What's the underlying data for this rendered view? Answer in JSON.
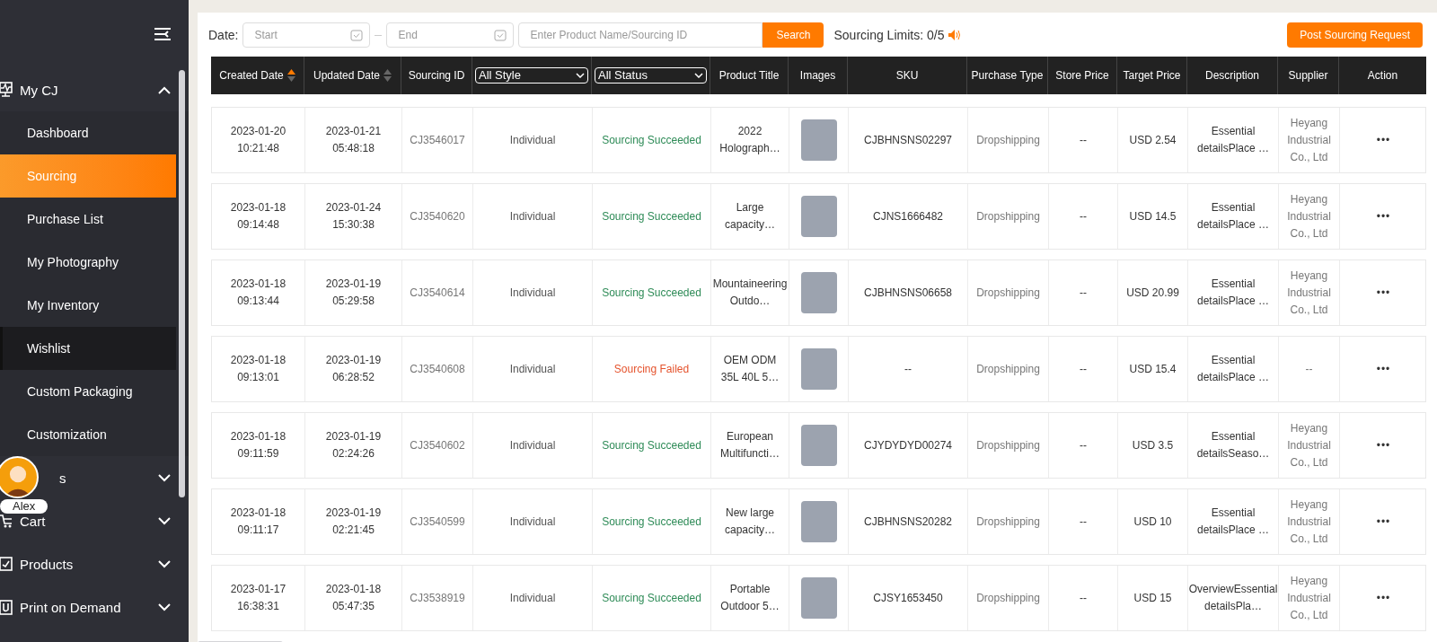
{
  "sidebar": {
    "groups": [
      {
        "label": "My CJ",
        "expanded": true,
        "children": [
          {
            "label": "Dashboard",
            "selected": false,
            "hovered": false
          },
          {
            "label": "Sourcing",
            "selected": true,
            "hovered": false
          },
          {
            "label": "Purchase List",
            "selected": false,
            "hovered": false
          },
          {
            "label": "My Photography",
            "selected": false,
            "hovered": false
          },
          {
            "label": "My Inventory",
            "selected": false,
            "hovered": false
          },
          {
            "label": "Wishlist",
            "selected": false,
            "hovered": true
          },
          {
            "label": "Custom Packaging",
            "selected": false,
            "hovered": false
          },
          {
            "label": "Customization",
            "selected": false,
            "hovered": false
          }
        ]
      },
      {
        "label": "s",
        "expanded": false
      },
      {
        "label": "Cart",
        "expanded": false
      },
      {
        "label": "Products",
        "expanded": false
      },
      {
        "label": "Print on Demand",
        "expanded": false
      }
    ],
    "user": {
      "name": "Alex"
    }
  },
  "toolbar": {
    "date_label": "Date:",
    "start_placeholder": "Start",
    "end_placeholder": "End",
    "search_placeholder": "Enter Product Name/Sourcing ID",
    "search_button": "Search",
    "limits": "Sourcing Limits: 0/5",
    "post_button": "Post Sourcing Request"
  },
  "table": {
    "columns": [
      {
        "kind": "sort",
        "label": "Created Date",
        "sorted": true
      },
      {
        "kind": "sort",
        "label": "Updated Date",
        "sorted": false
      },
      {
        "kind": "text",
        "label": "Sourcing ID"
      },
      {
        "kind": "select",
        "label": "All Style"
      },
      {
        "kind": "select",
        "label": "All Status"
      },
      {
        "kind": "text",
        "label": "Product Title"
      },
      {
        "kind": "text",
        "label": "Images"
      },
      {
        "kind": "text",
        "label": "SKU"
      },
      {
        "kind": "text",
        "label": "Purchase Type"
      },
      {
        "kind": "text",
        "label": "Store Price"
      },
      {
        "kind": "text",
        "label": "Target Price"
      },
      {
        "kind": "text",
        "label": "Description"
      },
      {
        "kind": "text",
        "label": "Supplier"
      },
      {
        "kind": "text",
        "label": "Action"
      }
    ],
    "rows": [
      {
        "created": "2023-01-20 10:21:48",
        "updated": "2023-01-21 05:48:18",
        "id": "CJ3546017",
        "style": "Individual",
        "status": "Sourcing Succeeded",
        "failed": false,
        "title": "2022 Holograph…",
        "sku": "CJBHNSNS02297",
        "purchase_type": "Dropshipping",
        "store_price": "--",
        "target_price": "USD 2.54",
        "description": "Essential detailsPlace …",
        "supplier": "Heyang Industrial Co., Ltd",
        "action": "•••"
      },
      {
        "created": "2023-01-18 09:14:48",
        "updated": "2023-01-24 15:30:38",
        "id": "CJ3540620",
        "style": "Individual",
        "status": "Sourcing Succeeded",
        "failed": false,
        "title": "Large capacity…",
        "sku": "CJNS1666482",
        "purchase_type": "Dropshipping",
        "store_price": "--",
        "target_price": "USD 14.5",
        "description": "Essential detailsPlace …",
        "supplier": "Heyang Industrial Co., Ltd",
        "action": "•••"
      },
      {
        "created": "2023-01-18 09:13:44",
        "updated": "2023-01-19 05:29:58",
        "id": "CJ3540614",
        "style": "Individual",
        "status": "Sourcing Succeeded",
        "failed": false,
        "title": "Mountaineering Outdo…",
        "sku": "CJBHNSNS06658",
        "purchase_type": "Dropshipping",
        "store_price": "--",
        "target_price": "USD 20.99",
        "description": "Essential detailsPlace …",
        "supplier": "Heyang Industrial Co., Ltd",
        "action": "•••"
      },
      {
        "created": "2023-01-18 09:13:01",
        "updated": "2023-01-19 06:28:52",
        "id": "CJ3540608",
        "style": "Individual",
        "status": "Sourcing Failed",
        "failed": true,
        "title": "OEM ODM 35L 40L 5…",
        "sku": "--",
        "purchase_type": "Dropshipping",
        "store_price": "--",
        "target_price": "USD 15.4",
        "description": "Essential detailsPlace …",
        "supplier": "--",
        "action": "•••"
      },
      {
        "created": "2023-01-18 09:11:59",
        "updated": "2023-01-19 02:24:26",
        "id": "CJ3540602",
        "style": "Individual",
        "status": "Sourcing Succeeded",
        "failed": false,
        "title": "European Multifuncti…",
        "sku": "CJYDYDYD00274",
        "purchase_type": "Dropshipping",
        "store_price": "--",
        "target_price": "USD 3.5",
        "description": "Essential detailsSeaso…",
        "supplier": "Heyang Industrial Co., Ltd",
        "action": "•••"
      },
      {
        "created": "2023-01-18 09:11:17",
        "updated": "2023-01-19 02:21:45",
        "id": "CJ3540599",
        "style": "Individual",
        "status": "Sourcing Succeeded",
        "failed": false,
        "title": "New large capacity…",
        "sku": "CJBHNSNS20282",
        "purchase_type": "Dropshipping",
        "store_price": "--",
        "target_price": "USD 10",
        "description": "Essential detailsPlace …",
        "supplier": "Heyang Industrial Co., Ltd",
        "action": "•••"
      },
      {
        "created": "2023-01-17 16:38:31",
        "updated": "2023-01-18 05:47:35",
        "id": "CJ3538919",
        "style": "Individual",
        "status": "Sourcing Succeeded",
        "failed": false,
        "title": "Portable Outdoor 5…",
        "sku": "CJSY1653450",
        "purchase_type": "Dropshipping",
        "store_price": "--",
        "target_price": "USD 15",
        "description": "OverviewEssential detailsPla…",
        "supplier": "Heyang Industrial Co., Ltd",
        "action": "•••"
      }
    ]
  }
}
